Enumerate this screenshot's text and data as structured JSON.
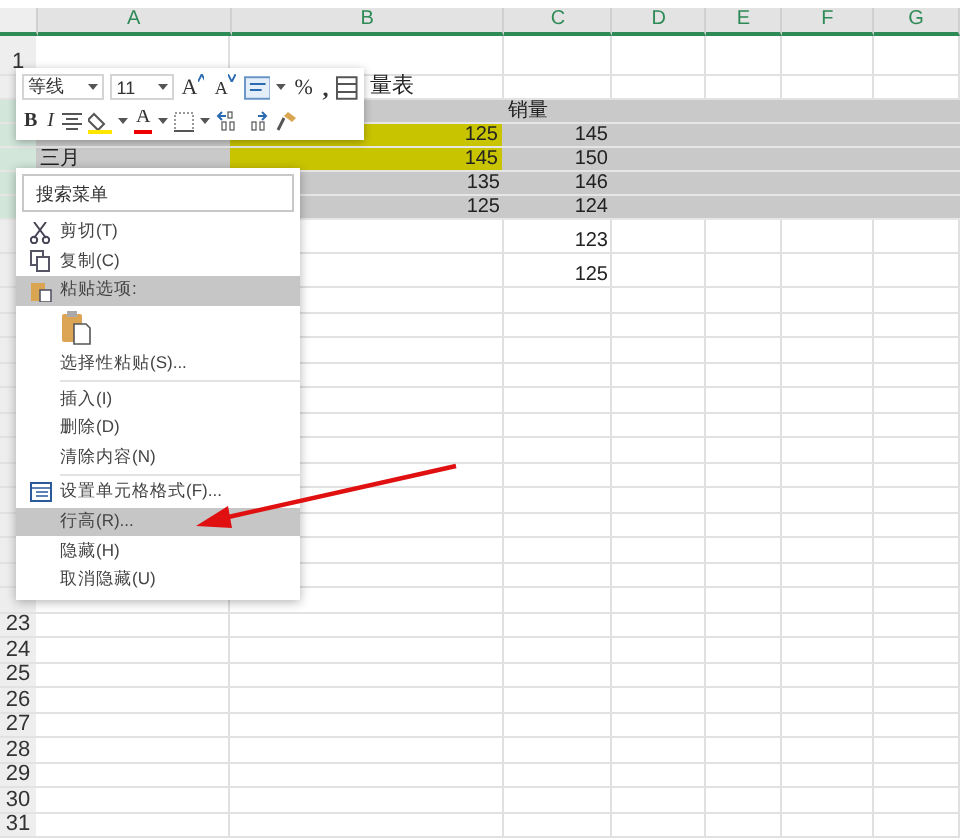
{
  "columns": [
    {
      "label": "A",
      "selected": true
    },
    {
      "label": "B",
      "selected": true
    },
    {
      "label": "C",
      "selected": true
    },
    {
      "label": "D",
      "selected": true
    },
    {
      "label": "E",
      "selected": true
    },
    {
      "label": "F",
      "selected": true
    },
    {
      "label": "G",
      "selected": true
    }
  ],
  "rows": [
    {
      "number": "1",
      "selected": false
    },
    {
      "selected": false,
      "b": {
        "kind": "title",
        "text": "量表"
      }
    },
    {
      "selected": true,
      "c": {
        "kind": "text",
        "text": "销量"
      }
    },
    {
      "selected": true,
      "b": {
        "kind": "number",
        "text": "125",
        "highlight": true
      },
      "c": {
        "kind": "number",
        "text": "145"
      }
    },
    {
      "selected": true,
      "a": {
        "kind": "text",
        "text": "三月"
      },
      "b": {
        "kind": "number",
        "text": "145",
        "highlight": true
      },
      "c": {
        "kind": "number",
        "text": "150"
      }
    },
    {
      "selected": true,
      "b": {
        "kind": "number",
        "text": "135"
      },
      "c": {
        "kind": "number",
        "text": "146"
      }
    },
    {
      "selected": true,
      "b": {
        "kind": "number",
        "text": "125"
      },
      "c": {
        "kind": "number",
        "text": "124"
      }
    },
    {
      "selected": false,
      "c": {
        "kind": "number",
        "text": "123"
      }
    },
    {
      "selected": false,
      "c": {
        "kind": "number",
        "text": "125"
      }
    },
    {
      "selected": false
    },
    {
      "selected": false
    },
    {
      "selected": false
    },
    {
      "selected": false
    },
    {
      "selected": false
    },
    {
      "selected": false
    },
    {
      "selected": false
    },
    {
      "selected": false
    },
    {
      "selected": false
    },
    {
      "selected": false
    },
    {
      "selected": false
    },
    {
      "selected": false
    },
    {
      "selected": false
    },
    {
      "number": "23",
      "selected": false
    },
    {
      "number": "24",
      "selected": false
    },
    {
      "number": "25",
      "selected": false
    },
    {
      "number": "26",
      "selected": false
    },
    {
      "number": "27",
      "selected": false
    },
    {
      "number": "28",
      "selected": false
    },
    {
      "number": "29",
      "selected": false
    },
    {
      "number": "30",
      "selected": false
    },
    {
      "number": "31",
      "selected": false
    }
  ],
  "mini_toolbar": {
    "font": "等线",
    "size": "11",
    "grow": "A",
    "shrink": "A",
    "percent": "%",
    "comma": ",",
    "bold": "B",
    "italic": "I",
    "font_color": "A"
  },
  "context_menu": {
    "search": {
      "placeholder": "搜索菜单"
    },
    "items": [
      {
        "kind": "command",
        "label": "剪切(T)",
        "selected": false
      },
      {
        "kind": "command",
        "label": "复制(C)",
        "selected": false
      },
      {
        "kind": "heading",
        "label": "粘贴选项:"
      },
      {
        "kind": "paste-options"
      },
      {
        "kind": "command",
        "label": "选择性粘贴(S)...",
        "selected": false
      },
      {
        "kind": "separator"
      },
      {
        "kind": "command",
        "label": "插入(I)",
        "selected": false
      },
      {
        "kind": "command",
        "label": "删除(D)",
        "selected": false
      },
      {
        "kind": "command",
        "label": "清除内容(N)",
        "selected": false
      },
      {
        "kind": "separator"
      },
      {
        "kind": "command",
        "label": "设置单元格格式(F)...",
        "selected": false
      },
      {
        "kind": "command",
        "label": "行高(R)...",
        "selected": true
      },
      {
        "kind": "command",
        "label": "隐藏(H)",
        "selected": false
      },
      {
        "kind": "command",
        "label": "取消隐藏(U)",
        "selected": false
      }
    ]
  }
}
